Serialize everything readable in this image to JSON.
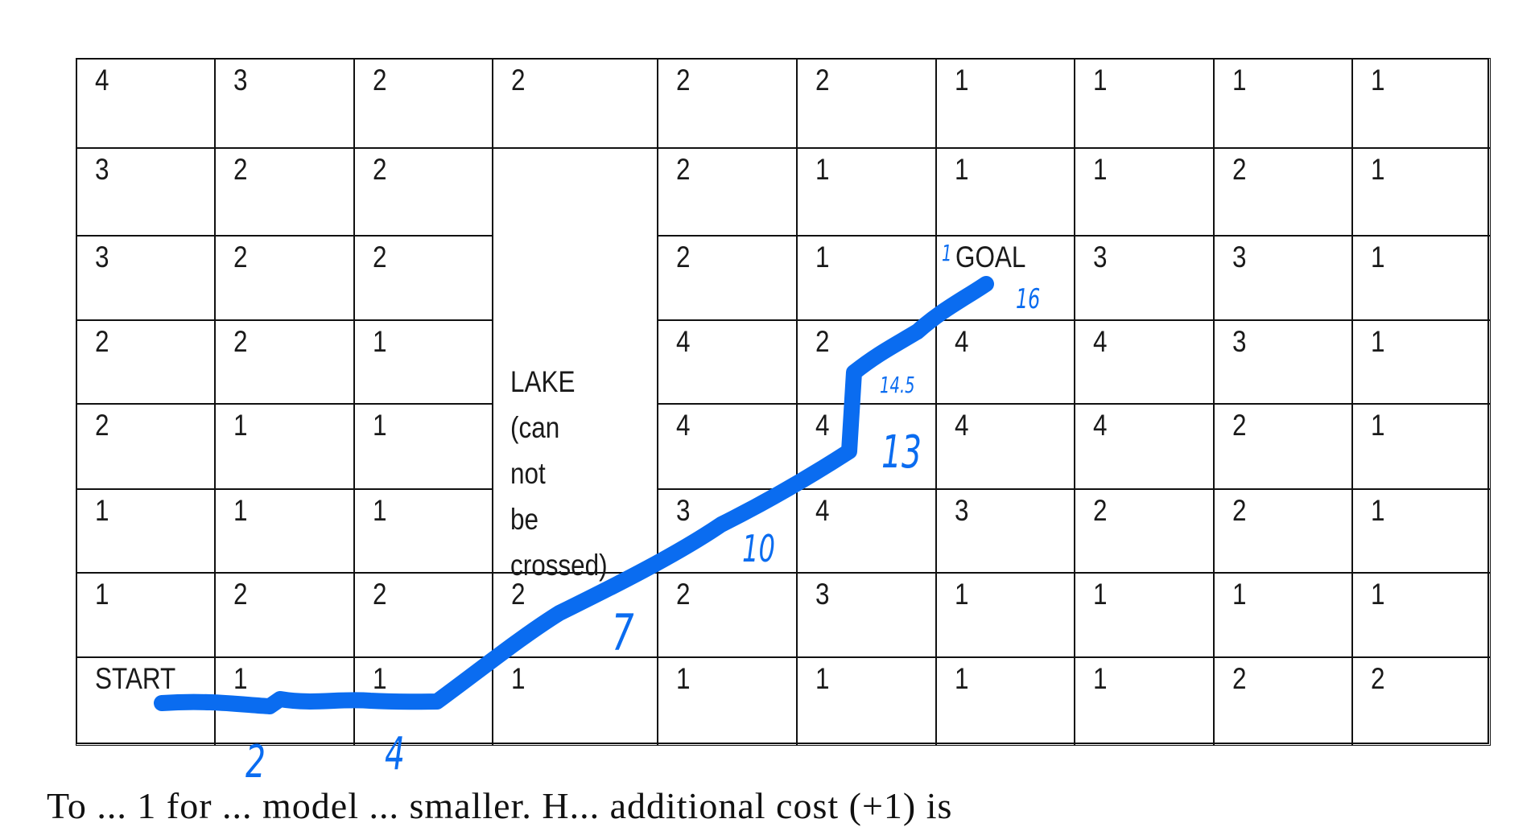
{
  "grid": {
    "rows": [
      [
        "4",
        "3",
        "2",
        "2",
        "2",
        "2",
        "1",
        "1",
        "1",
        "1"
      ],
      [
        "3",
        "2",
        "2",
        null,
        "2",
        "1",
        "1",
        "1",
        "2",
        "1"
      ],
      [
        "3",
        "2",
        "2",
        null,
        "2",
        "1",
        "GOAL",
        "3",
        "3",
        "1"
      ],
      [
        "2",
        "2",
        "1",
        null,
        "4",
        "2",
        "4",
        "4",
        "3",
        "1"
      ],
      [
        "2",
        "1",
        "1",
        null,
        "4",
        "4",
        "4",
        "4",
        "2",
        "1"
      ],
      [
        "1",
        "1",
        "1",
        null,
        "3",
        "4",
        "3",
        "2",
        "2",
        "1"
      ],
      [
        "1",
        "2",
        "2",
        "2",
        "2",
        "3",
        "1",
        "1",
        "1",
        "1"
      ],
      [
        "START",
        "1",
        "1",
        "1",
        "1",
        "1",
        "1",
        "1",
        "2",
        "2"
      ]
    ],
    "lake_lines": [
      "LAKE",
      "(can",
      "not",
      "be",
      "crossed)"
    ]
  },
  "annotations": {
    "ink_color": "#0a6cf0",
    "labels": [
      "2",
      "4",
      "7",
      "10",
      "13",
      "14.5",
      "16",
      "1"
    ]
  },
  "caption": "To ... 1 for ... model ... smaller. H... additional cost (+1) is"
}
